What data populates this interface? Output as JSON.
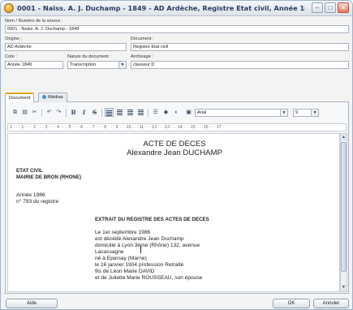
{
  "window": {
    "title": "0001 - Naiss. A. J. Duchamp - 1849 - AD Ardèche, Registre Etat civil, Année 1849, classeur D",
    "min_label": "–",
    "max_label": "□",
    "close_label": "×"
  },
  "form": {
    "source_name_label": "Nom / Numéro de la source :",
    "source_name_value": "0001 - Naiss. A. J. Duchamp - 1849",
    "origin_label": "Origine :",
    "origin_value": "AD Ardèche",
    "document_label": "Document :",
    "document_value": "Registre Etat civil",
    "cote_label": "Cote :",
    "cote_value": "Année 1849",
    "doc_type_label": "Nature du document :",
    "doc_type_value": "Transcription",
    "archivage_label": "Archivage :",
    "archivage_value": "classeur D"
  },
  "tabs": [
    {
      "label": "Document"
    },
    {
      "label": "Médias"
    }
  ],
  "toolbar": {
    "bold_label": "B",
    "italic_label": "I",
    "strike_label": "S",
    "font_value": "Arial",
    "size_value": "9"
  },
  "ruler_text": "1 · · · 1 · · · 2 · · · 3 · · · 4 · · · 5 · · · 6 · · · 7 · · · 8 · · · 9 · · ·10 · · ·11 · · ·12 · · ·13 · · ·14 · · ·15 · · ·16 · · ·17 ·",
  "document": {
    "title": "ACTE DE DECES",
    "subtitle": "Alexandre Jean DUCHAMP",
    "etat_civil": "ETAT CIVIL",
    "mairie": "MAIRIE DE BRON (RHONE)",
    "annee": "Année 1986",
    "numero": "n° 793 du registre",
    "extrait": "EXTRAIT DU REGISTRE DES ACTES DE DECES",
    "body": [
      "Le 1er septembre 1986",
      "est décédé Alexandre Jean Duchamp",
      "domicilié à Lyon 3ème (Rhône) 132, avenue",
      "Lacassagne",
      "né à Epersay (Marne)",
      "le 16 janvier 1904 profession Retraité",
      "fils de Léon Marie DAVID",
      "et de Juliette Marie ROUSSEAU, son épouse"
    ]
  },
  "buttons": {
    "help": "Aide",
    "ok": "OK",
    "cancel": "Annuler"
  },
  "colors": {
    "title_text": "#2a3c66",
    "accent": "#e8a21a",
    "close_button": "#e27a68"
  }
}
